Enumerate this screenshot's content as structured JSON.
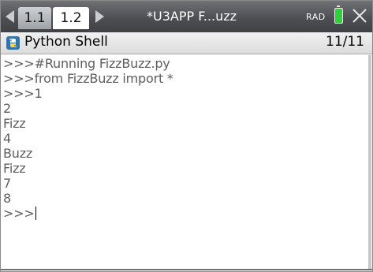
{
  "tabbar": {
    "tab1_label": "1.1",
    "tab2_label": "1.2",
    "document_title": "*U3APP F...uzz",
    "angle_mode": "RAD",
    "battery_color": "#2fd13b"
  },
  "app": {
    "name": "Python Shell",
    "page_indicator": "11/11"
  },
  "shell": {
    "lines": [
      ">>>#Running FizzBuzz.py",
      ">>>from FizzBuzz import *",
      ">>>1",
      "2",
      "Fizz",
      "4",
      "Buzz",
      "Fizz",
      "7",
      "8"
    ],
    "prompt": ">>>"
  },
  "colors": {
    "tabbar_bg": "#4d4f53",
    "output_text": "#5e5e5e",
    "python_icon_blue": "#3572a5",
    "python_icon_yellow": "#ffd43b"
  },
  "icons": [
    "chevron-left-icon",
    "chevron-right-icon",
    "battery-icon",
    "close-icon",
    "python-icon"
  ]
}
